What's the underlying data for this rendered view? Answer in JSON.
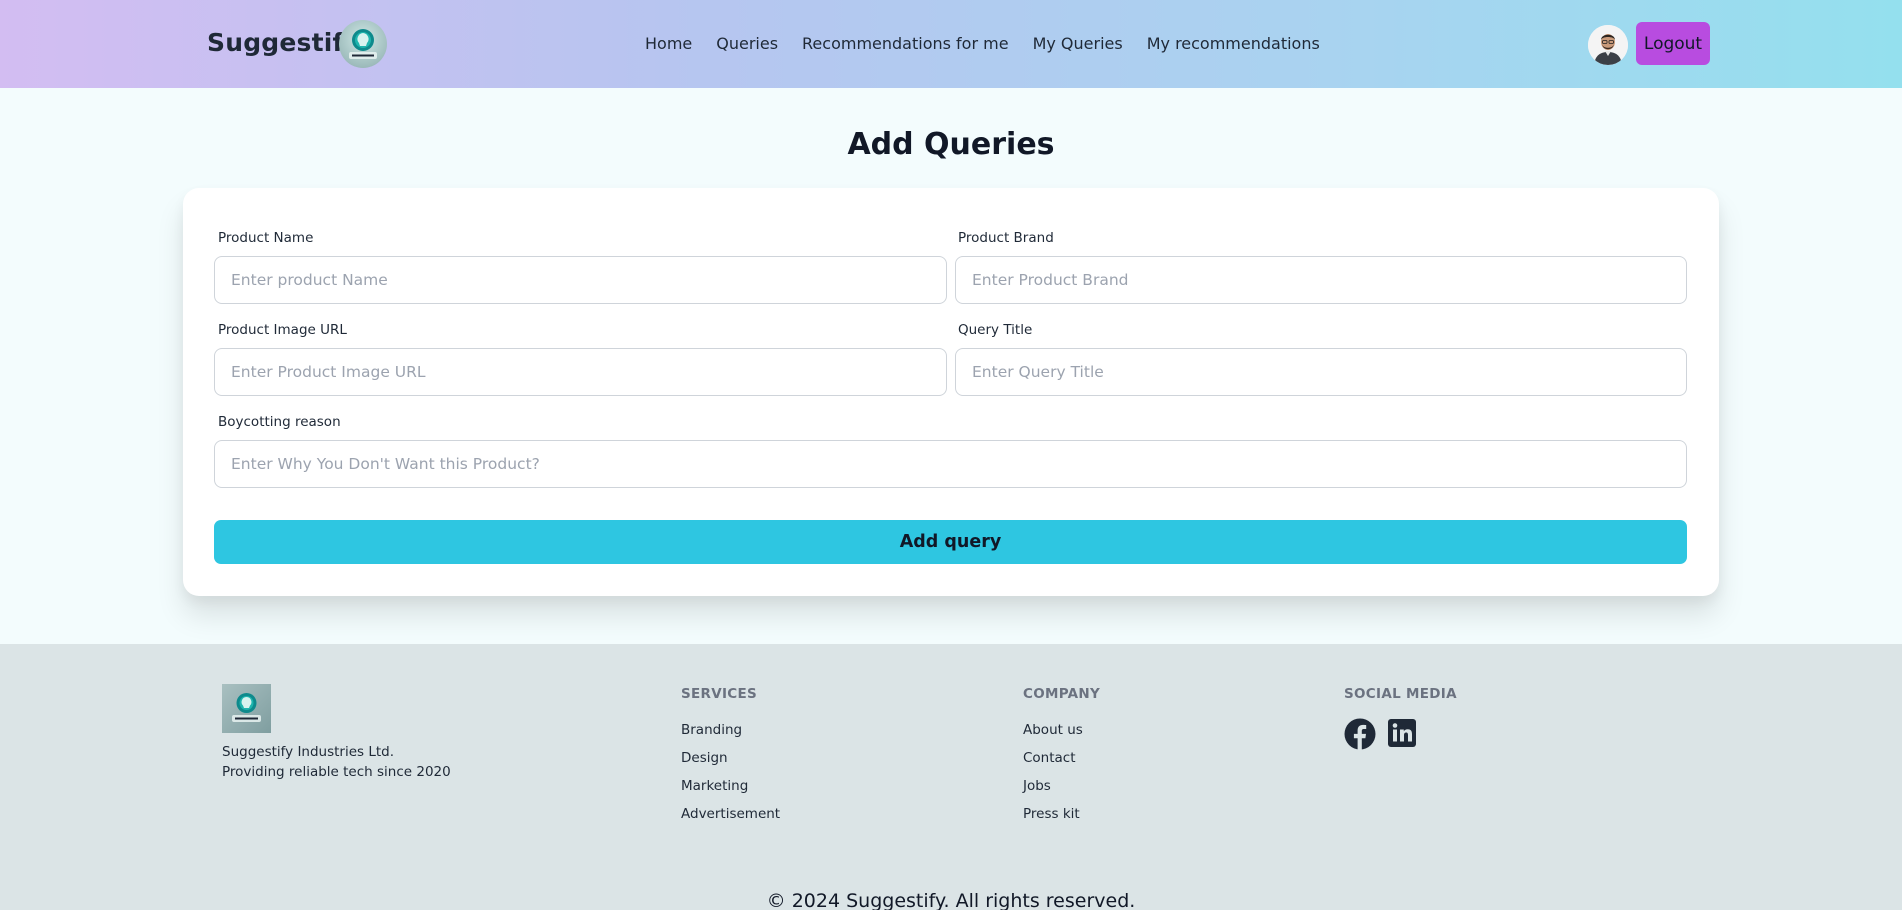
{
  "navbar": {
    "brand": "Suggestify",
    "links": [
      "Home",
      "Queries",
      "Recommendations for me",
      "My Queries",
      "My recommendations"
    ],
    "logout_label": "Logout"
  },
  "page": {
    "title": "Add Queries"
  },
  "form": {
    "product_name": {
      "label": "Product Name",
      "placeholder": "Enter product Name",
      "value": ""
    },
    "product_brand": {
      "label": "Product Brand",
      "placeholder": "Enter Product Brand",
      "value": ""
    },
    "product_image_url": {
      "label": "Product Image URL",
      "placeholder": "Enter Product Image URL",
      "value": ""
    },
    "query_title": {
      "label": "Query Title",
      "placeholder": "Enter Query Title",
      "value": ""
    },
    "boycotting_reason": {
      "label": "Boycotting reason",
      "placeholder": "Enter Why You Don't Want this Product?",
      "value": ""
    },
    "submit_label": "Add query"
  },
  "footer": {
    "company_name": "Suggestify Industries Ltd.",
    "company_tagline": "Providing reliable tech since 2020",
    "services": {
      "title": "SERVICES",
      "items": [
        "Branding",
        "Design",
        "Marketing",
        "Advertisement"
      ]
    },
    "company": {
      "title": "COMPANY",
      "items": [
        "About us",
        "Contact",
        "Jobs",
        "Press kit"
      ]
    },
    "social": {
      "title": "SOCIAL MEDIA",
      "icons": [
        "facebook-icon",
        "linkedin-icon"
      ]
    },
    "copyright": "© 2024 Suggestify. All rights reserved."
  },
  "colors": {
    "accent": "#2ec6e1",
    "logout": "#b84ce0",
    "footer_bg": "#dbe4e6"
  }
}
